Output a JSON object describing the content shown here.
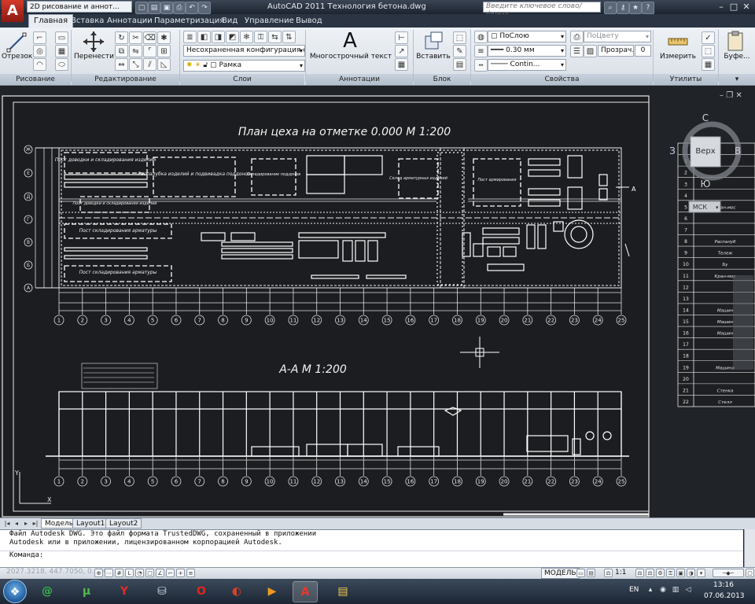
{
  "window": {
    "title": "AutoCAD 2011   Технология бетона.dwg",
    "workspace": "2D рисование и аннот...",
    "search_placeholder": "Введите ключевое слово/фразу"
  },
  "ribbon": {
    "tabs": [
      "Главная",
      "Вставка",
      "Аннотации",
      "Параметризация",
      "Вид",
      "Управление",
      "Вывод"
    ],
    "active_tab": "Главная",
    "panels": [
      "Рисование",
      "Редактирование",
      "Слои",
      "Аннотации",
      "Блок",
      "Свойства",
      "Утилиты"
    ],
    "draw": {
      "line_label": "Отрезок"
    },
    "modify": {
      "move_label": "Перенести"
    },
    "layers": {
      "layer_state": "Несохраненная конфигурация сл",
      "current_layer": "Рамка"
    },
    "annotation": {
      "text_label": "Многострочный текст"
    },
    "block": {
      "insert_label": "Вставить"
    },
    "properties": {
      "color": "ПоСлою",
      "lineweight": "0.30 мм",
      "linetype": "Contin...",
      "plotstyle": "ПоЦвету",
      "transparency_label": "Прозрач...",
      "transparency_value": "0"
    },
    "utilities": {
      "measure_label": "Измерить",
      "clipboard_label": "Буфе..."
    }
  },
  "drawing": {
    "plan_title": "План цеха на отметке 0.000  М 1:200",
    "section_title": "А-А  М 1:200",
    "section_marker": "А",
    "axis_numbers": [
      "1",
      "2",
      "3",
      "4",
      "5",
      "6",
      "7",
      "8",
      "9",
      "10",
      "11",
      "12",
      "13",
      "14",
      "15",
      "16",
      "17",
      "18",
      "19",
      "20",
      "21",
      "22",
      "23",
      "24",
      "25"
    ],
    "axis_letters": [
      "А",
      "Б",
      "В",
      "Г",
      "Д",
      "Е",
      "Ж"
    ],
    "zones": {
      "zone1": "Пост доводки и складирования изделий",
      "zone2": "Распалубка изделий и подвивадка поддонов",
      "zone3": "Складирование поддонов",
      "zone4": "Пост доводки и складирования изделий",
      "zone5": "Пост складирования арматуры",
      "zone6": "Пост складирования арматуры",
      "zone7": "Склад арматурных изделий",
      "zone8": "Пост армирования"
    },
    "spec_rows": [
      "1",
      "2",
      "3",
      "4",
      "5",
      "6",
      "7",
      "8",
      "9",
      "10",
      "11",
      "12",
      "13",
      "14",
      "15",
      "16",
      "17",
      "18",
      "19",
      "20",
      "21",
      "22"
    ],
    "spec_texts": {
      "r5": "Кран-мос",
      "r8": "Распалуб",
      "r9": "Тележ",
      "r10": "Бу",
      "r11": "Кран-мос",
      "r14": "Машин",
      "r15": "Машин",
      "r16": "Машин",
      "r19": "Машина",
      "r21": "Стенка",
      "r22": "Стелл"
    },
    "viewcube": {
      "face": "Верх",
      "north": "С",
      "south": "Ю",
      "west": "З",
      "east": "В",
      "ucs": "МСК"
    }
  },
  "layouts": {
    "model": "Модель",
    "layout1": "Layout1",
    "layout2": "Layout2"
  },
  "command": {
    "line1": "Файл Autodesk DWG. Это файл формата TrustedDWG, сохраненный в приложении",
    "line2": "Autodesk или в приложении, лицензированном корпорацией Autodesk.",
    "prompt": "Команда:"
  },
  "status": {
    "coords": "2027.3218, 447.7050, 0.0000",
    "mode": "МОДЕЛЬ",
    "scale": "1:1"
  },
  "taskbar": {
    "lang": "EN",
    "time": "13:16",
    "date": "07.06.2013"
  },
  "colors": {
    "accent": "#c62d1f",
    "canvas": "#202327",
    "ribbon": "#e6ebf1"
  }
}
